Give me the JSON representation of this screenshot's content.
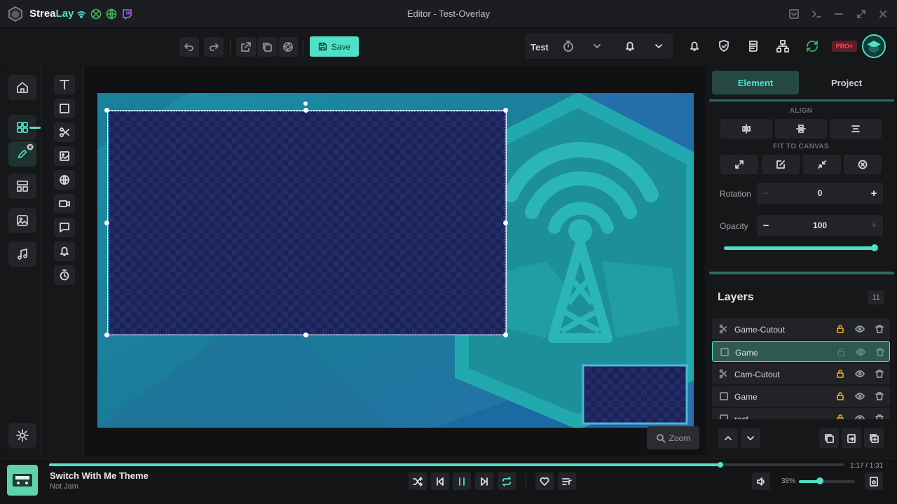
{
  "app": {
    "brand_prefix": "Strea",
    "brand_suffix": "Lay",
    "window_title": "Editor - Test-Overlay"
  },
  "toolbar": {
    "save_label": "Save",
    "scene_label": "Test",
    "pro_badge": "PRO+"
  },
  "panel": {
    "tabs": [
      "Element",
      "Project"
    ],
    "active_tab": "Element",
    "align_label": "ALIGN",
    "fit_label": "FIT TO CANVAS",
    "rotation_label": "Rotation",
    "rotation_value": "0",
    "opacity_label": "Opacity",
    "opacity_value": "100",
    "opacity_minus": "−",
    "opacity_plus": "+",
    "rotation_minus": "−",
    "rotation_plus": "+"
  },
  "layers": {
    "title": "Layers",
    "count": "11",
    "items": [
      {
        "name": "Game-Cutout",
        "icon": "scissors-icon",
        "selected": false
      },
      {
        "name": "Game",
        "icon": "square-icon",
        "selected": true
      },
      {
        "name": "Cam-Cutout",
        "icon": "scissors-icon",
        "selected": false
      },
      {
        "name": "Game",
        "icon": "square-icon",
        "selected": false
      },
      {
        "name": "rect",
        "icon": "square-icon",
        "selected": false
      }
    ]
  },
  "canvas": {
    "zoom_label": "Zoom"
  },
  "player": {
    "title": "Switch With Me Theme",
    "artist": "Not Jam",
    "time": "1:17 / 1:31",
    "progress": 0.845,
    "volume_label": "38%",
    "volume": 0.38
  },
  "colors": {
    "accent": "#4fe0c6",
    "background": "#151618",
    "panel": "#161719",
    "pro": "#ff4b5c"
  }
}
